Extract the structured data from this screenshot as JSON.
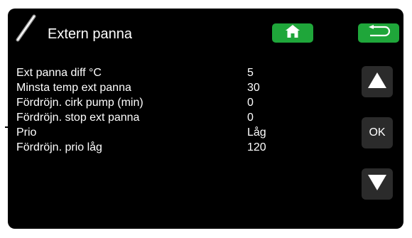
{
  "header": {
    "title": "Extern panna",
    "title_icon": "thermometer-probe-icon",
    "home_icon": "home-icon",
    "back_icon": "return-arrow-icon",
    "button_color": "#1fa63a"
  },
  "settings": [
    {
      "label": "Ext panna diff °C",
      "value": "5"
    },
    {
      "label": "Minsta temp ext panna",
      "value": "30"
    },
    {
      "label": "Fördröjn. cirk pump (min)",
      "value": "0"
    },
    {
      "label": "Fördröjn. stop ext panna",
      "value": "0"
    },
    {
      "label": "Prio",
      "value": "Låg"
    },
    {
      "label": "Fördröjn. prio låg",
      "value": "120"
    }
  ],
  "controls": {
    "up_icon": "arrow-up-icon",
    "ok_label": "OK",
    "down_icon": "arrow-down-icon"
  }
}
